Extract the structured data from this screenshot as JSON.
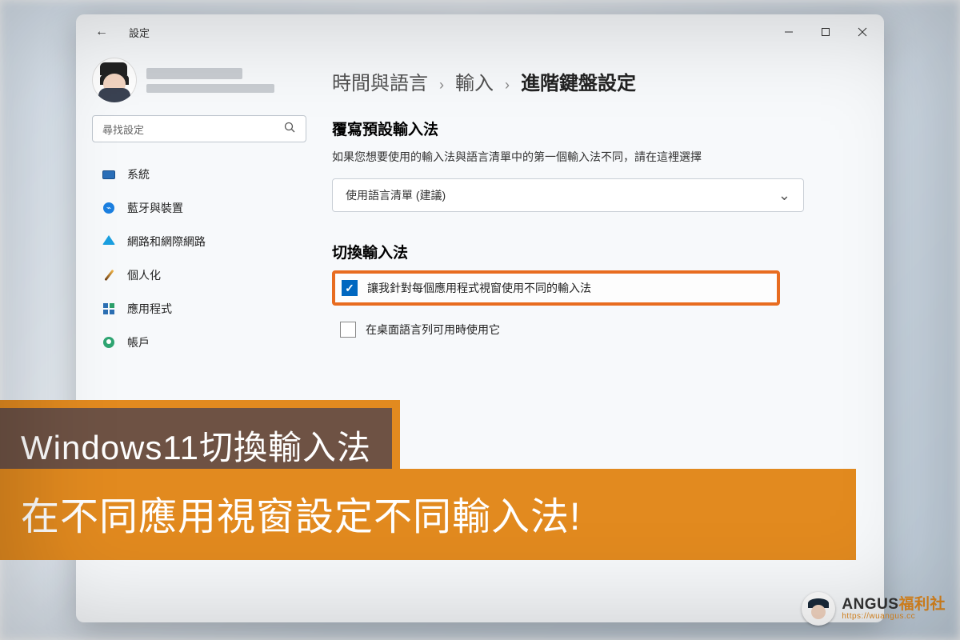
{
  "titlebar": {
    "app_name": "設定"
  },
  "search": {
    "placeholder": "尋找設定"
  },
  "sidebar": {
    "items": [
      {
        "label": "系統"
      },
      {
        "label": "藍牙與裝置"
      },
      {
        "label": "網路和網際網路"
      },
      {
        "label": "個人化"
      },
      {
        "label": "應用程式"
      },
      {
        "label": "帳戶"
      }
    ]
  },
  "breadcrumb": {
    "level1": "時間與語言",
    "level2": "輸入",
    "level3": "進階鍵盤設定",
    "separator": "›"
  },
  "override": {
    "title": "覆寫預設輸入法",
    "desc": "如果您想要使用的輸入法與語言清單中的第一個輸入法不同，請在這裡選擇",
    "select_value": "使用語言清單 (建議)"
  },
  "switch": {
    "title": "切換輸入法",
    "opt1": {
      "label": "讓我針對每個應用程式視窗使用不同的輸入法",
      "checked": true
    },
    "opt2": {
      "label": "在桌面語言列可用時使用它",
      "checked": false
    }
  },
  "overlay": {
    "line1": "Windows11切換輸入法",
    "line2": "在不同應用視窗設定不同輸入法!"
  },
  "watermark": {
    "brand_pre": "ANGUS",
    "brand_post": "福利社",
    "url": "https://wuangus.cc"
  },
  "chevron_down": "⌄",
  "checkmark": "✓"
}
